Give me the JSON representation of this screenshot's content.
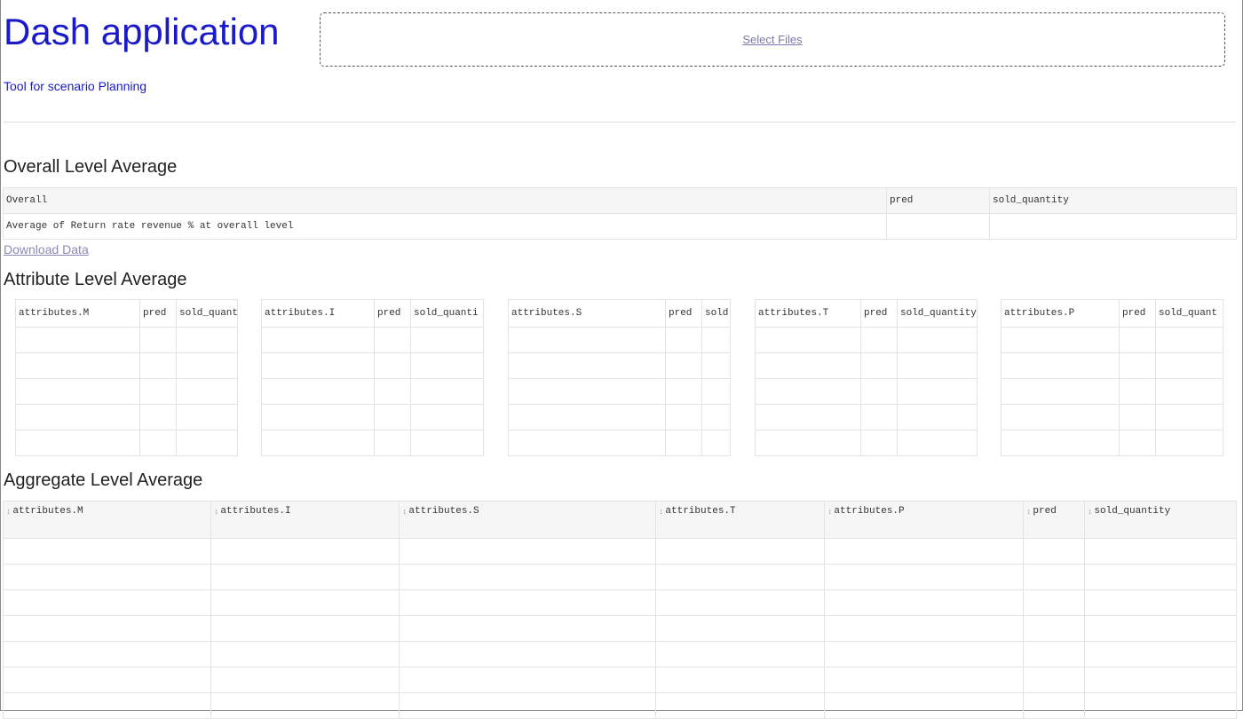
{
  "header": {
    "title": "Dash application",
    "subtitle": "Tool for scenario Planning",
    "upload_label": "Select Files"
  },
  "overall": {
    "title": "Overall Level Average",
    "columns": [
      "Overall",
      "pred",
      "sold_quantity"
    ],
    "rows": [
      [
        "Average of Return rate revenue % at overall level",
        "",
        ""
      ]
    ],
    "download_label": "Download Data"
  },
  "attribute": {
    "title": "Attribute Level Average",
    "tables": [
      {
        "columns": [
          "attributes.M",
          "pred",
          "sold_quant"
        ]
      },
      {
        "columns": [
          "attributes.I",
          "pred",
          "sold_quanti"
        ]
      },
      {
        "columns": [
          "attributes.S",
          "pred",
          "sold"
        ]
      },
      {
        "columns": [
          "attributes.T",
          "pred",
          "sold_quantity"
        ]
      },
      {
        "columns": [
          "attributes.P",
          "pred",
          "sold_quant"
        ]
      }
    ],
    "row_count": 5
  },
  "aggregate": {
    "title": "Aggregate Level Average",
    "columns": [
      "attributes.M",
      "attributes.I",
      "attributes.S",
      "attributes.T",
      "attributes.P",
      "pred",
      "sold_quantity"
    ],
    "sort_icon": "sort-arrows-icon",
    "row_count": 7
  }
}
